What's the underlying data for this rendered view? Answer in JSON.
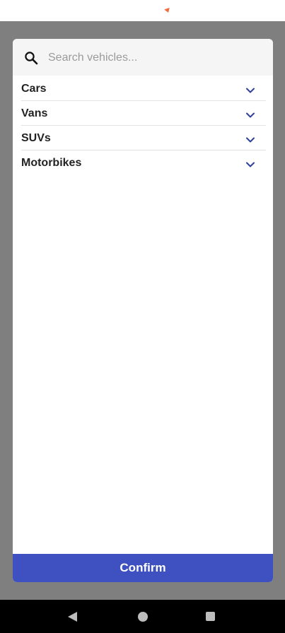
{
  "search": {
    "placeholder": "Search vehicles...",
    "value": "",
    "icon": "search-icon"
  },
  "categories": [
    {
      "label": "Cars",
      "icon": "chevron-down-icon"
    },
    {
      "label": "Vans",
      "icon": "chevron-down-icon"
    },
    {
      "label": "SUVs",
      "icon": "chevron-down-icon"
    },
    {
      "label": "Motorbikes",
      "icon": "chevron-down-icon"
    }
  ],
  "confirm": {
    "label": "Confirm"
  },
  "colors": {
    "accent": "#3f51c0",
    "chevron": "#2f3f9c",
    "backdrop": "#7f7f7f",
    "notification": "#f26b3a"
  },
  "nav": {
    "back_icon": "back-icon",
    "home_icon": "home-icon",
    "recents_icon": "recents-icon"
  }
}
